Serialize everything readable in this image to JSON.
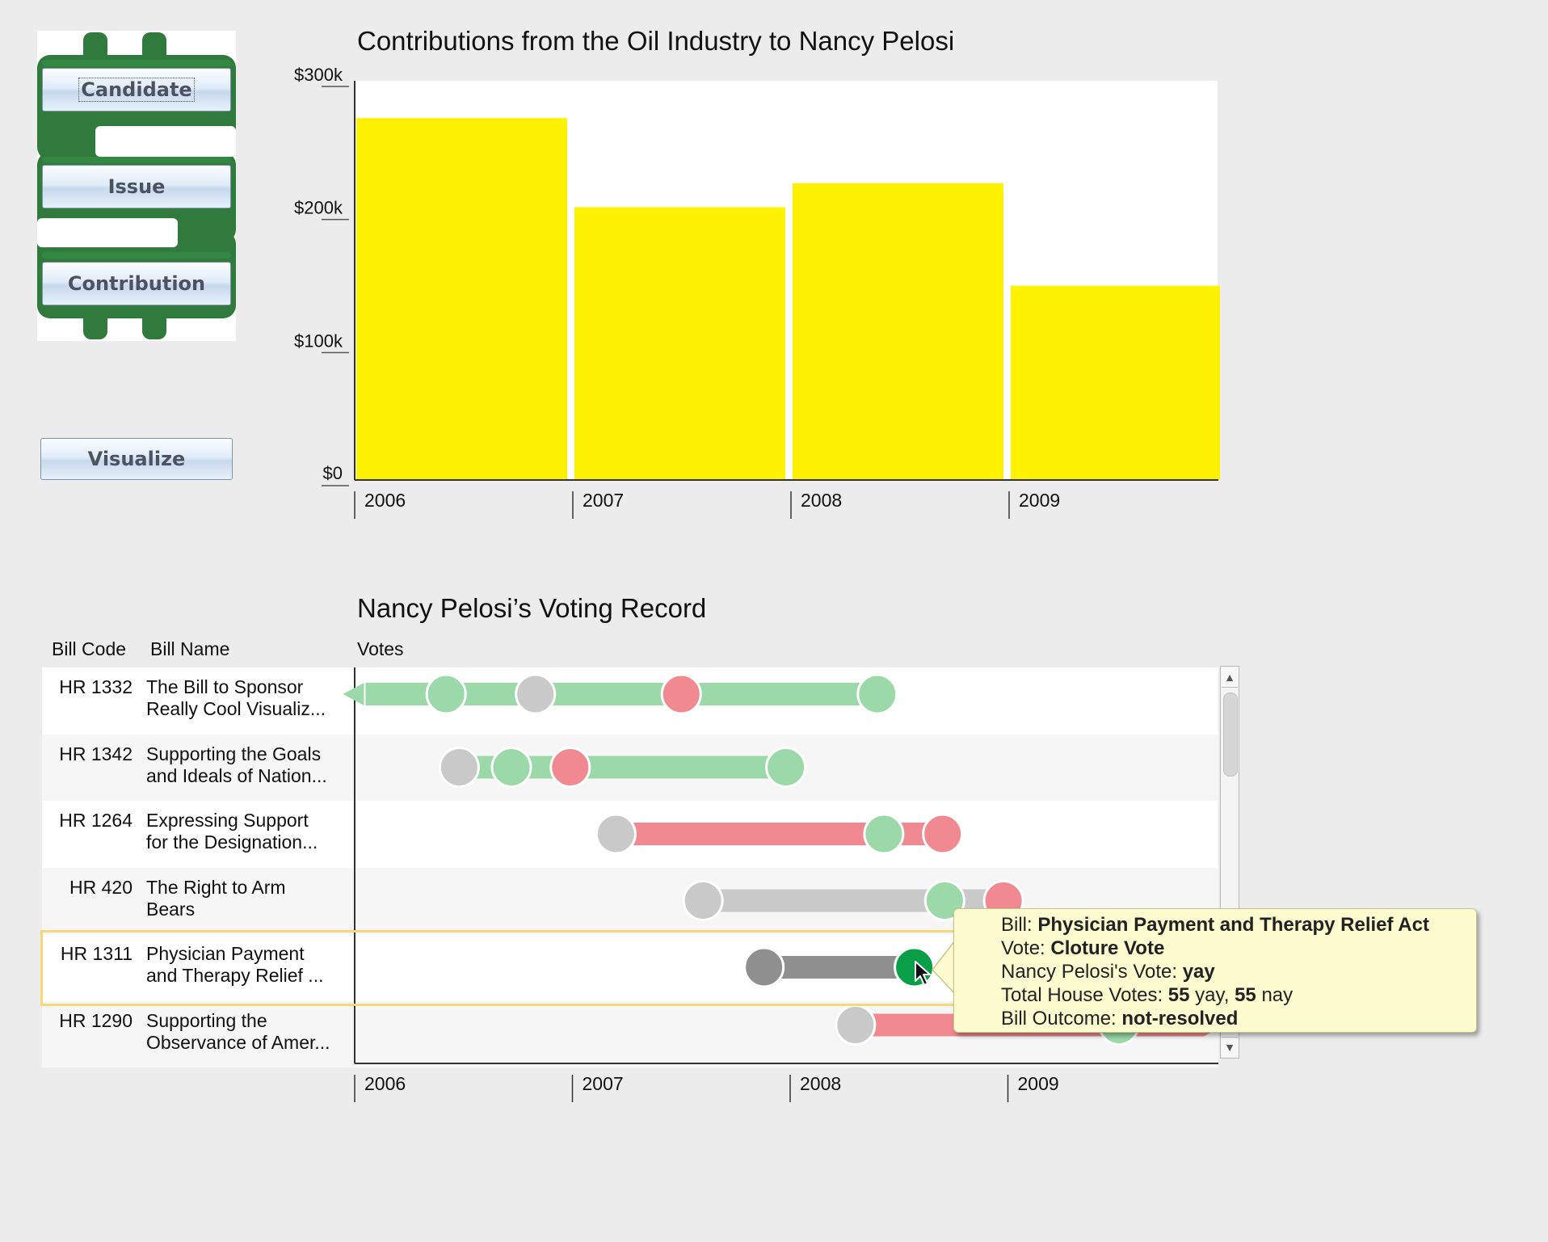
{
  "buttons": {
    "candidate": "Candidate",
    "issue": "Issue",
    "contribution": "Contribution",
    "visualize": "Visualize"
  },
  "contributions": {
    "title": "Contributions from the Oil Industry to Nancy Pelosi"
  },
  "voting": {
    "title": "Nancy Pelosi’s Voting Record",
    "headers": {
      "bill_code": "Bill Code",
      "bill_name": "Bill Name",
      "votes": "Votes"
    },
    "bills": [
      {
        "code": "HR 1332",
        "name": "The Bill to Sponsor\nReally Cool Visualiz...",
        "bar_color": "#9bd9a8",
        "start": 2006.05,
        "end": 2008.42,
        "arrow_left": true,
        "votes": [
          {
            "year": 2006.42,
            "color": "#9bd9a8"
          },
          {
            "year": 2006.83,
            "color": "#c9c9c9"
          },
          {
            "year": 2007.5,
            "color": "#f08a90"
          },
          {
            "year": 2008.4,
            "color": "#9bd9a8"
          }
        ]
      },
      {
        "code": "HR 1342",
        "name": "Supporting the Goals\nand Ideals of Nation...",
        "bar_color": "#9bd9a8",
        "start": 2006.48,
        "end": 2008.0,
        "votes": [
          {
            "year": 2006.48,
            "color": "#c9c9c9"
          },
          {
            "year": 2006.72,
            "color": "#9bd9a8"
          },
          {
            "year": 2006.99,
            "color": "#f08a90"
          },
          {
            "year": 2007.98,
            "color": "#9bd9a8"
          }
        ]
      },
      {
        "code": "HR 1264",
        "name": "Expressing Support\nfor the Designation...",
        "bar_color": "#f08a90",
        "start": 2007.2,
        "end": 2008.7,
        "votes": [
          {
            "year": 2007.2,
            "color": "#c9c9c9"
          },
          {
            "year": 2008.43,
            "color": "#9bd9a8"
          },
          {
            "year": 2008.7,
            "color": "#f08a90"
          }
        ]
      },
      {
        "code": "HR 420",
        "name": "The Right to Arm\nBears",
        "bar_color": "#c9c9c9",
        "start": 2007.6,
        "end": 2008.98,
        "votes": [
          {
            "year": 2007.6,
            "color": "#c9c9c9"
          },
          {
            "year": 2008.71,
            "color": "#9bd9a8"
          },
          {
            "year": 2008.98,
            "color": "#f08a90"
          }
        ]
      },
      {
        "code": "HR 1311",
        "name": "Physician Payment\nand Therapy Relief ...",
        "bar_color": "#8f8f8f",
        "start": 2007.88,
        "end": 2008.57,
        "selected": true,
        "votes": [
          {
            "year": 2007.88,
            "color": "#8f8f8f"
          },
          {
            "year": 2008.57,
            "color": "#0a9e48"
          }
        ]
      },
      {
        "code": "HR 1290",
        "name": "Supporting the\nObservance of Amer...",
        "bar_color": "#f08a90",
        "start": 2008.3,
        "end": 2009.9,
        "arrow_right": true,
        "votes": [
          {
            "year": 2008.3,
            "color": "#c9c9c9"
          },
          {
            "year": 2009.51,
            "color": "#9bd9a8"
          }
        ]
      }
    ],
    "tooltip": {
      "bill_label": "Bill:",
      "bill_value": "Physician Payment and Therapy Relief Act",
      "vote_label": "Vote:",
      "vote_value": "Cloture Vote",
      "member_label": "Nancy Pelosi's Vote:",
      "member_value": "yay",
      "total_label": "Total House Votes:",
      "total_yay": "55",
      "yay_word": "yay,",
      "total_nay": "55",
      "nay_word": "nay",
      "outcome_label": "Bill Outcome:",
      "outcome_value": "not-resolved"
    },
    "x_ticks": [
      "2006",
      "2007",
      "2008",
      "2009"
    ]
  },
  "chart_data": {
    "type": "bar",
    "title": "Contributions from the Oil Industry to Nancy Pelosi",
    "categories": [
      "2006",
      "2007",
      "2008",
      "2009"
    ],
    "values": [
      272000,
      205000,
      223000,
      146000
    ],
    "ylim": [
      0,
      300000
    ],
    "y_ticks": [
      "$300k",
      "$200k",
      "$100k",
      "$0"
    ],
    "bar_color": "#fff200",
    "grid": false
  }
}
